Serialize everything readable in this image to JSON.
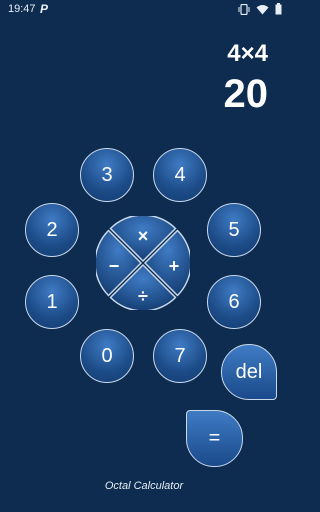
{
  "status": {
    "time": "19:47",
    "app_indicator": "P",
    "icons": [
      "vibrate-icon",
      "wifi-icon",
      "battery-icon"
    ]
  },
  "display": {
    "expression": "4×4",
    "result": "20"
  },
  "digits": {
    "d0": "0",
    "d1": "1",
    "d2": "2",
    "d3": "3",
    "d4": "4",
    "d5": "5",
    "d6": "6",
    "d7": "7"
  },
  "operators": {
    "multiply": "×",
    "minus": "−",
    "plus": "+",
    "divide": "÷"
  },
  "actions": {
    "delete": "del",
    "equals": "="
  },
  "footer": "Octal Calculator",
  "colors": {
    "background": "#0d2c50",
    "button": "#1c4b87",
    "button_border": "#c9d8ea"
  }
}
